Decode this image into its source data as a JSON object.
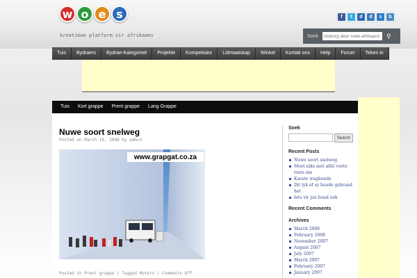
{
  "header": {
    "logo_letters": [
      {
        "letter": "w",
        "color": "#d62b2b"
      },
      {
        "letter": "o",
        "color": "#2f9a3d"
      },
      {
        "letter": "e",
        "color": "#e28a1c"
      },
      {
        "letter": "s",
        "color": "#2b6cb8"
      }
    ],
    "tagline": "kreatiewe platform vir afrikaans",
    "social_icons": [
      {
        "name": "facebook-icon",
        "glyph": "f",
        "color": "#3b5998"
      },
      {
        "name": "twitter-icon",
        "glyph": "t",
        "color": "#33aadd"
      },
      {
        "name": "delicious-icon",
        "glyph": "d",
        "color": "#2a66b5"
      },
      {
        "name": "digg-icon",
        "glyph": "d",
        "color": "#3a78b8"
      },
      {
        "name": "stumbleupon-icon",
        "glyph": "s",
        "color": "#2f7cc1"
      },
      {
        "name": "bookmark-icon",
        "glyph": "b",
        "color": "#4a89cc"
      }
    ],
    "search": {
      "label": "Soek",
      "placeholder": "Geborg deur soek-afrikaans"
    }
  },
  "main_nav": [
    "Tuis",
    "Bydraers",
    "Bydrae-Kategorieë",
    "Projekte",
    "Kompetisies",
    "Lidmaatskap",
    "Winkel",
    "Kontak ons",
    "Help",
    "Forum",
    "Teken in"
  ],
  "sub_nav": [
    "Tuis",
    "Kort grappe",
    "Prent grappe",
    "Lang Grappe"
  ],
  "post": {
    "title": "Nuwe soort snelweg",
    "meta": "Posted on March 10, 2008 by admin",
    "image_watermark": "www.grapgat.co.za",
    "footer": "Posted in Prent grappe | Tagged Motors | Comments Off"
  },
  "sidebar": {
    "search_heading": "Soek",
    "search_button": "Search",
    "recent_posts_heading": "Recent Posts",
    "recent_posts": [
      "Nuwe soort snelweg",
      "Moet niks met alleî voete toets nie",
      "Karate waghonde",
      "Dit lyk of sy boude gebrand het",
      "Iets vir jou hond ook"
    ],
    "recent_comments_heading": "Recent Comments",
    "archives_heading": "Archives",
    "archives": [
      "March 2008",
      "February 2008",
      "November 2007",
      "August 2007",
      "July 2007",
      "March 2007",
      "February 2007",
      "January 2007"
    ]
  }
}
